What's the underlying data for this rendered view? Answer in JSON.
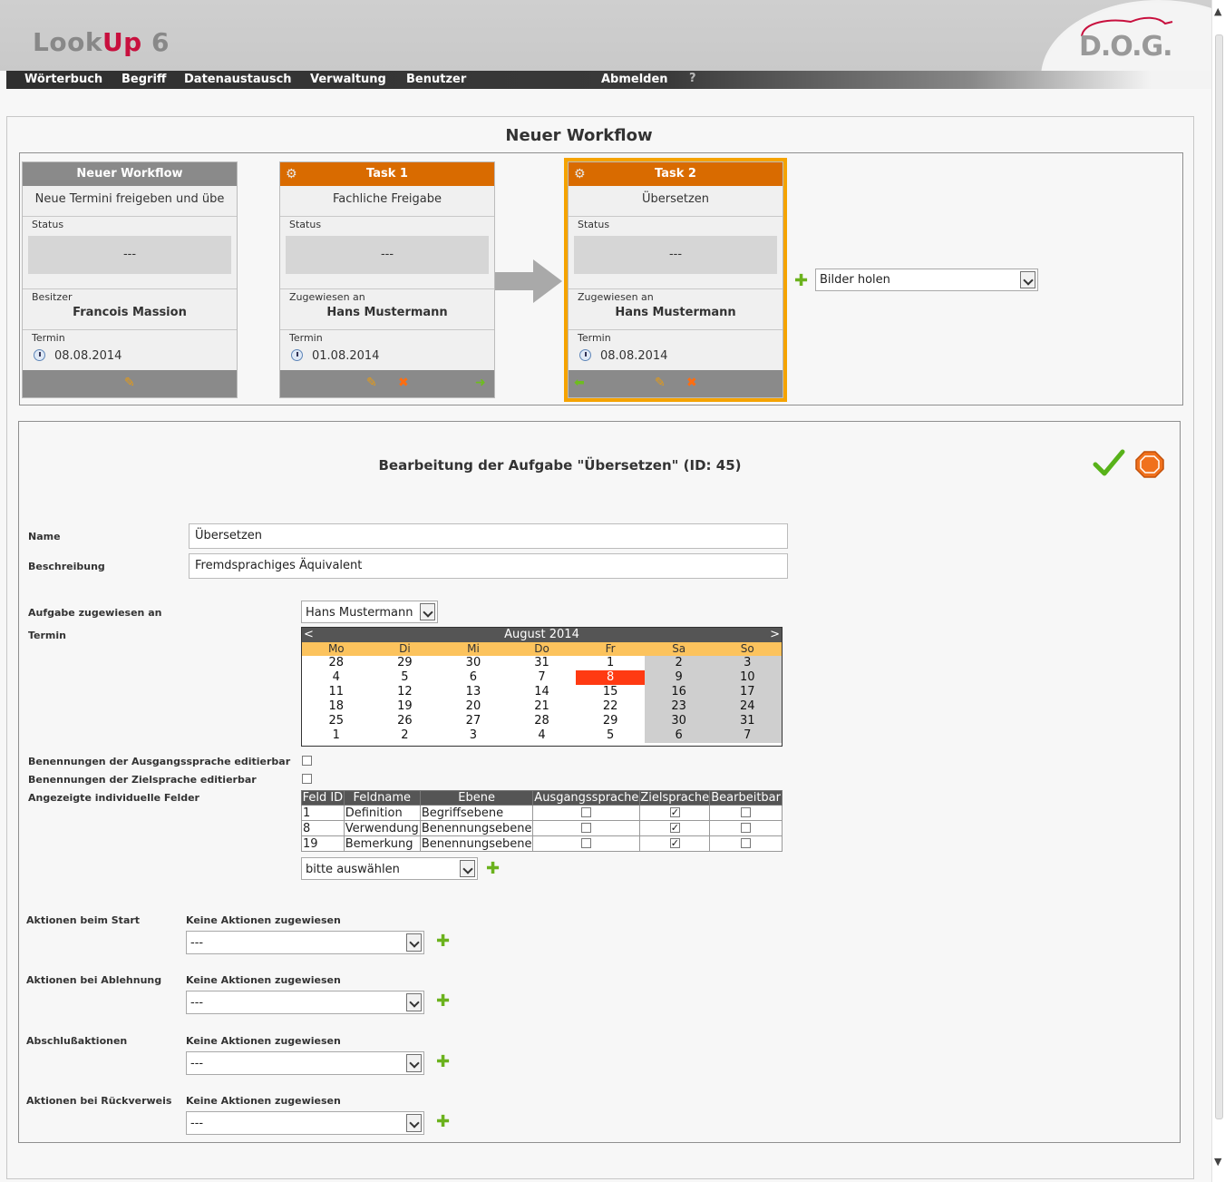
{
  "app": {
    "logo_main": "Look",
    "logo_accent": "Up",
    "logo_version": "6",
    "brand": "D.O.G."
  },
  "nav": {
    "items": [
      "Wörterbuch",
      "Begriff",
      "Datenaustausch",
      "Verwaltung",
      "Benutzer"
    ],
    "logout": "Abmelden",
    "help": "?"
  },
  "workflow": {
    "title": "Neuer Workflow",
    "cards": [
      {
        "header": "Neuer Workflow",
        "description": "Neue Termini freigeben und übe",
        "status_label": "Status",
        "status_value": "---",
        "person_label": "Besitzer",
        "person": "Francois Massion",
        "date_label": "Termin",
        "date": "08.08.2014"
      },
      {
        "header": "Task 1",
        "description": "Fachliche Freigabe",
        "status_label": "Status",
        "status_value": "---",
        "person_label": "Zugewiesen an",
        "person": "Hans Mustermann",
        "date_label": "Termin",
        "date": "01.08.2014"
      },
      {
        "header": "Task 2",
        "description": "Übersetzen",
        "status_label": "Status",
        "status_value": "---",
        "person_label": "Zugewiesen an",
        "person": "Hans Mustermann",
        "date_label": "Termin",
        "date": "08.08.2014"
      }
    ],
    "add_task_select": "Bilder holen"
  },
  "edit": {
    "title": "Bearbeitung der Aufgabe \"Übersetzen\" (ID: 45)",
    "name_label": "Name",
    "name_value": "Übersetzen",
    "desc_label": "Beschreibung",
    "desc_value": "Fremdsprachiges Äquivalent",
    "assign_label": "Aufgabe zugewiesen an",
    "assign_value": "Hans Mustermann",
    "date_label": "Termin",
    "src_edit_label": "Benennungen der Ausgangssprache editierbar",
    "tgt_edit_label": "Benennungen der Zielsprache editierbar",
    "fields_label": "Angezeigte individuelle Felder",
    "field_select": "bitte auswählen"
  },
  "calendar": {
    "month": "August 2014",
    "prev": "<",
    "next": ">",
    "weekdays": [
      "Mo",
      "Di",
      "Mi",
      "Do",
      "Fr",
      "Sa",
      "So"
    ],
    "weeks": [
      [
        "28",
        "29",
        "30",
        "31",
        "1",
        "2",
        "3"
      ],
      [
        "4",
        "5",
        "6",
        "7",
        "8",
        "9",
        "10"
      ],
      [
        "11",
        "12",
        "13",
        "14",
        "15",
        "16",
        "17"
      ],
      [
        "18",
        "19",
        "20",
        "21",
        "22",
        "23",
        "24"
      ],
      [
        "25",
        "26",
        "27",
        "28",
        "29",
        "30",
        "31"
      ],
      [
        "1",
        "2",
        "3",
        "4",
        "5",
        "6",
        "7"
      ]
    ],
    "selected": "8",
    "accent_color": "#ff3a12"
  },
  "fields_table": {
    "headers": [
      "Feld ID",
      "Feldname",
      "Ebene",
      "Ausgangssprache",
      "Zielsprache",
      "Bearbeitbar"
    ],
    "rows": [
      {
        "id": "1",
        "name": "Definition",
        "level": "Begriffsebene",
        "source": false,
        "target": true,
        "editable": false
      },
      {
        "id": "8",
        "name": "Verwendung",
        "level": "Benennungsebene",
        "source": false,
        "target": true,
        "editable": false
      },
      {
        "id": "19",
        "name": "Bemerkung",
        "level": "Benennungsebene",
        "source": false,
        "target": true,
        "editable": false
      }
    ]
  },
  "actions": [
    {
      "label": "Aktionen beim Start",
      "status": "Keine Aktionen zugewiesen",
      "select": "---"
    },
    {
      "label": "Aktionen bei Ablehnung",
      "status": "Keine Aktionen zugewiesen",
      "select": "---"
    },
    {
      "label": "Abschlußaktionen",
      "status": "Keine Aktionen zugewiesen",
      "select": "---"
    },
    {
      "label": "Aktionen bei Rückverweis",
      "status": "Keine Aktionen zugewiesen",
      "select": "---"
    }
  ],
  "colors": {
    "task_header": "#d96b00",
    "selected_outline": "#f5a300",
    "nav_bg": "#333333",
    "add_icon": "#6bb21d"
  }
}
